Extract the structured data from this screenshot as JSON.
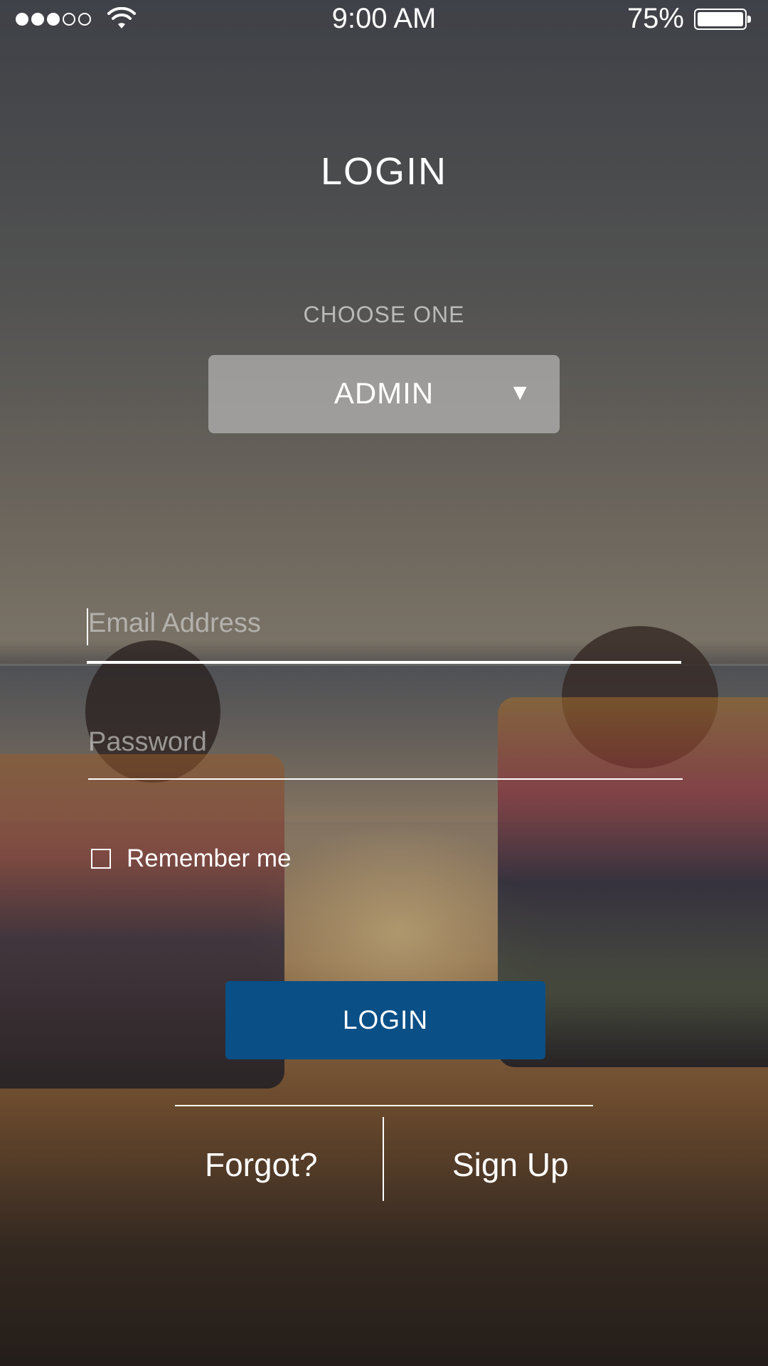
{
  "status_bar": {
    "time": "9:00 AM",
    "battery_percent": "75%",
    "signal_bars_filled": 3,
    "signal_bars_total": 5
  },
  "page": {
    "title": "LOGIN"
  },
  "role_picker": {
    "label": "CHOOSE ONE",
    "selected": "ADMIN",
    "arrow": "▼"
  },
  "form": {
    "email_placeholder": "Email Address",
    "password_placeholder": "Password",
    "remember_label": "Remember me",
    "remember_checked": false,
    "login_button": "LOGIN"
  },
  "footer": {
    "forgot_label": "Forgot?",
    "signup_label": "Sign Up"
  },
  "colors": {
    "login_button_bg": "#0a4f86",
    "select_bg": "rgba(200,200,200,0.6)"
  }
}
